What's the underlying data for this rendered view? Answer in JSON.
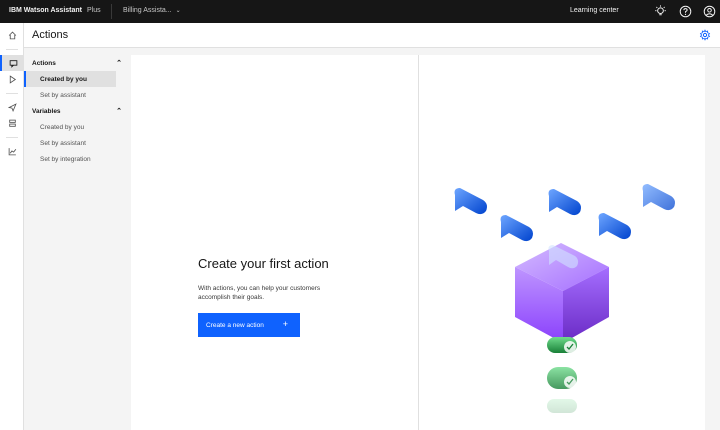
{
  "topbar": {
    "brand": "IBM Watson Assistant",
    "plan": "Plus",
    "assistant_name": "Billing Assista...",
    "learning_center": "Learning center",
    "icons": [
      "lightbulb-icon",
      "help-icon",
      "user-avatar-icon"
    ]
  },
  "rail": {
    "items": [
      "home-icon",
      "actions-icon",
      "preview-icon",
      "publish-icon",
      "environments-icon",
      "analytics-icon"
    ],
    "active": "actions-icon"
  },
  "header": {
    "title": "Actions",
    "settings_icon": "gear-icon"
  },
  "nav": {
    "actions_group": "Actions",
    "actions_items": [
      "Created by you",
      "Set by assistant"
    ],
    "variables_group": "Variables",
    "variables_items": [
      "Created by you",
      "Set by assistant",
      "Set by integration"
    ],
    "selected": "Created by you"
  },
  "empty_state": {
    "title": "Create your first action",
    "description": "With actions, you can help your customers accomplish their goals.",
    "button_label": "Create a new action",
    "button_icon": "+"
  },
  "colors": {
    "accent": "#0f62fe",
    "topbar": "#161616",
    "cube": "#a56eff",
    "check": "#24a148"
  }
}
